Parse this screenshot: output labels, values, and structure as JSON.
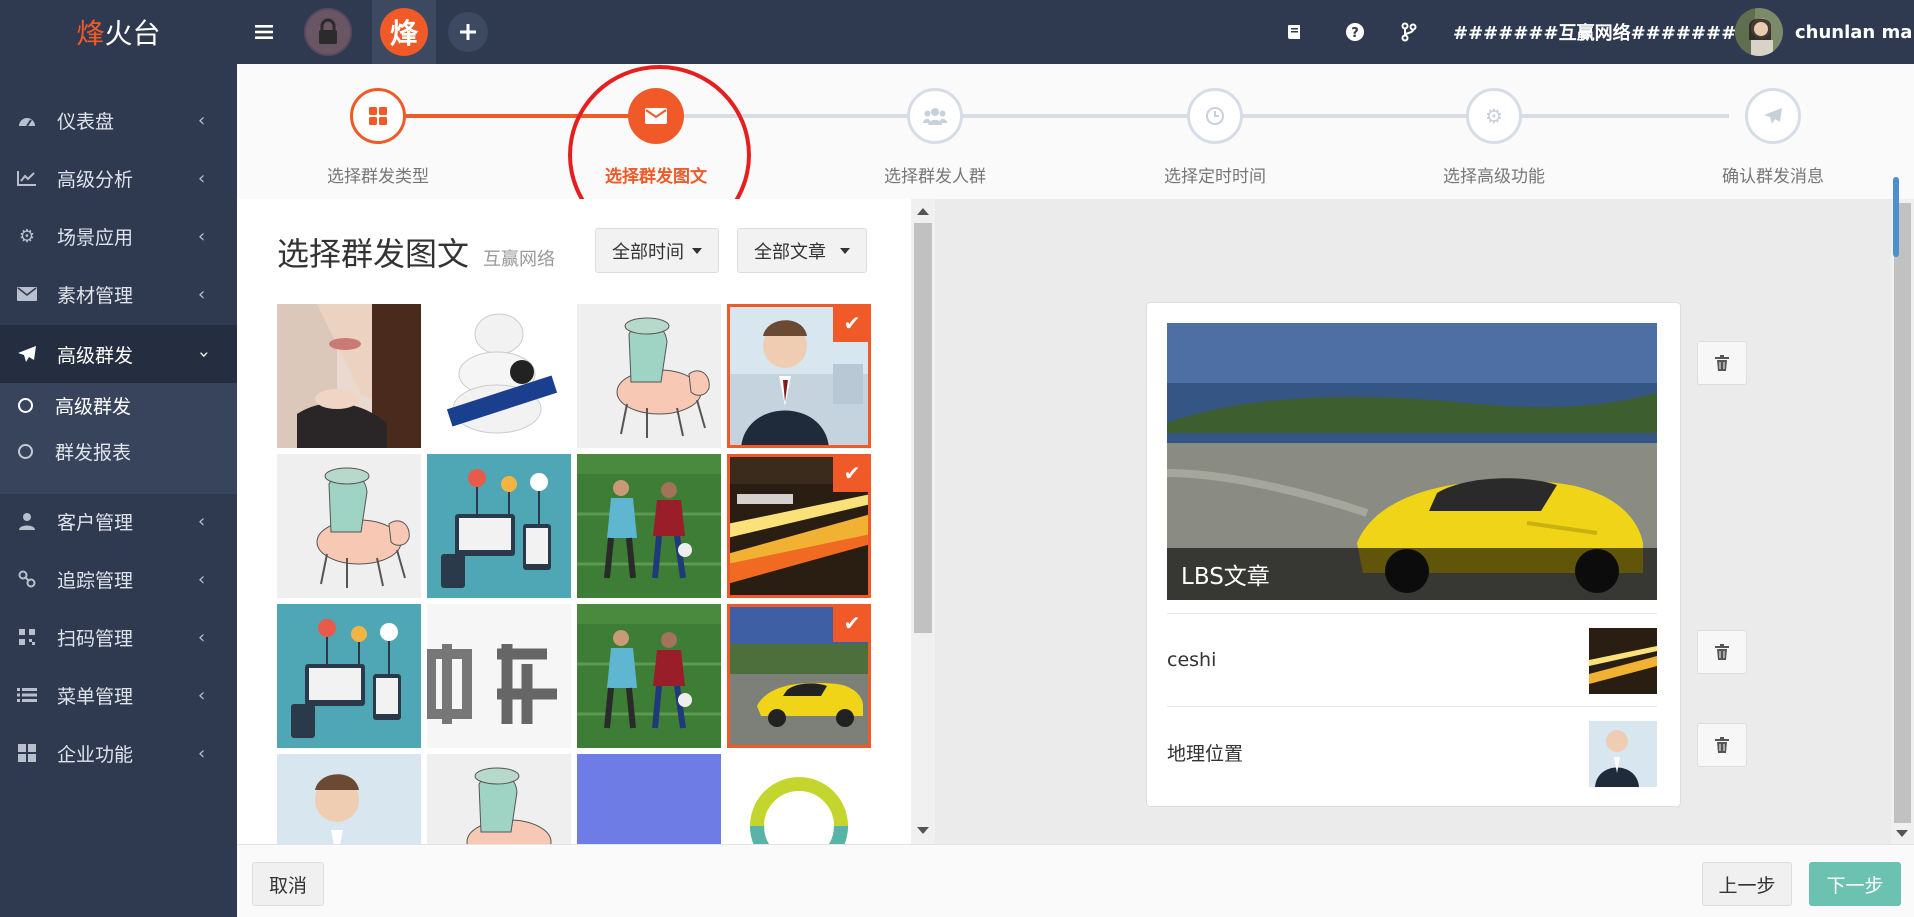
{
  "app": {
    "logo_highlight": "烽",
    "logo_rest": "火台"
  },
  "topbar": {
    "account": "#######互赢网络#######",
    "user": "chunlan ma",
    "icons": [
      "menu-icon",
      "book-icon",
      "question-icon",
      "branch-icon",
      "plus-icon"
    ]
  },
  "sidebar": {
    "items": [
      {
        "label": "仪表盘",
        "icon": "dashboard-icon"
      },
      {
        "label": "高级分析",
        "icon": "line-chart-icon"
      },
      {
        "label": "场景应用",
        "icon": "gear-icon"
      },
      {
        "label": "素材管理",
        "icon": "envelope-icon"
      },
      {
        "label": "高级群发",
        "icon": "paper-plane-icon"
      },
      {
        "label": "客户管理",
        "icon": "user-icon"
      },
      {
        "label": "追踪管理",
        "icon": "link-icon"
      },
      {
        "label": "扫码管理",
        "icon": "qrcode-icon"
      },
      {
        "label": "菜单管理",
        "icon": "list-icon"
      },
      {
        "label": "企业功能",
        "icon": "grid-icon"
      }
    ],
    "sub_items": [
      {
        "label": "高级群发"
      },
      {
        "label": "群发报表"
      }
    ]
  },
  "steps": [
    {
      "label": "选择群发类型",
      "icon": "grid-icon",
      "state": "done"
    },
    {
      "label": "选择群发图文",
      "icon": "envelope-icon",
      "state": "current"
    },
    {
      "label": "选择群发人群",
      "icon": "users-icon",
      "state": "todo"
    },
    {
      "label": "选择定时时间",
      "icon": "clock-icon",
      "state": "todo"
    },
    {
      "label": "选择高级功能",
      "icon": "gear-icon",
      "state": "todo"
    },
    {
      "label": "确认群发消息",
      "icon": "paper-plane-icon",
      "state": "todo"
    }
  ],
  "picker": {
    "title": "选择群发图文",
    "subtitle": "互赢网络",
    "time_filter": "全部时间",
    "article_filter": "全部文章"
  },
  "preview": {
    "main_title": "LBS文章",
    "items": [
      {
        "title": "ceshi"
      },
      {
        "title": "地理位置"
      }
    ]
  },
  "footer": {
    "cancel": "取消",
    "prev": "上一步",
    "next": "下一步"
  },
  "colors": {
    "accent": "#f05a28",
    "sidebar": "#2f3a50",
    "primary_button": "#6cc2b0"
  }
}
